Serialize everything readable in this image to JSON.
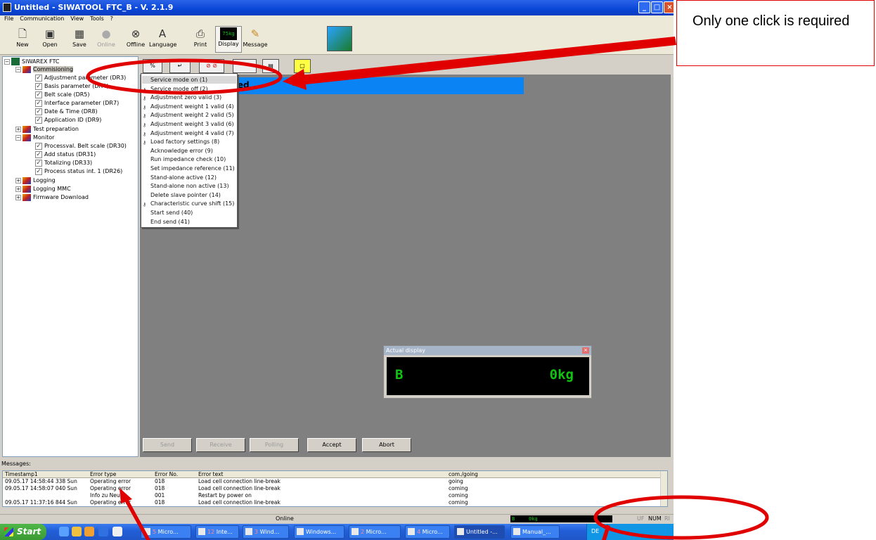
{
  "window": {
    "title": "Untitled - SIWATOOL FTC_B - V. 2.1.9",
    "menu": [
      "File",
      "Communication",
      "View",
      "Tools",
      "?"
    ]
  },
  "toolbar": {
    "new": "New",
    "open": "Open",
    "save": "Save",
    "online": "Online",
    "offline": "Offline",
    "language": "Language",
    "print": "Print",
    "display": "Display",
    "message": "Message",
    "display_icon_text": "75kg"
  },
  "tree": {
    "root": "SIWAREX FTC",
    "commissioning": "Commisioning",
    "commissioning_items": [
      "Adjustment parameter (DR3)",
      "Basis parameter (DR4)",
      "Belt scale (DR5)",
      "Interface parameter (DR7)",
      "Date & Time (DR8)",
      "Application ID (DR9)"
    ],
    "test_preparation": "Test preparation",
    "monitor": "Monitor",
    "monitor_items": [
      "Processval. Belt scale (DR30)",
      "Add status (DR31)",
      "Totalizing (DR33)",
      "Process status int. 1 (DR26)"
    ],
    "logging": "Logging",
    "logging_mmc": "Logging MMC",
    "firmware": "Firmware Download"
  },
  "main": {
    "banner_text": "cted",
    "subtool_icon_1": "%",
    "subtool_icon_2": "↵"
  },
  "dropdown": {
    "items": [
      {
        "label": "Service mode on (1)",
        "key": false,
        "highlight": true
      },
      {
        "label": "Service mode off (2)",
        "key": true,
        "highlight": false
      },
      {
        "label": "Adjustment zero valid (3)",
        "key": true,
        "highlight": false
      },
      {
        "label": "Adjustment weight 1 valid (4)",
        "key": true,
        "highlight": false
      },
      {
        "label": "Adjustment weight 2 valid (5)",
        "key": true,
        "highlight": false
      },
      {
        "label": "Adjustment weight 3 valid (6)",
        "key": true,
        "highlight": false
      },
      {
        "label": "Adjustment weight 4 valid (7)",
        "key": true,
        "highlight": false
      },
      {
        "label": "Load factory settings (8)",
        "key": true,
        "highlight": false
      },
      {
        "label": "Acknowledge error (9)",
        "key": false,
        "highlight": false
      },
      {
        "label": "Run impedance check (10)",
        "key": false,
        "highlight": false
      },
      {
        "label": "Set impedance reference (11)",
        "key": false,
        "highlight": false
      },
      {
        "label": "Stand-alone active (12)",
        "key": false,
        "highlight": false
      },
      {
        "label": "Stand-alone non active (13)",
        "key": false,
        "highlight": false
      },
      {
        "label": "Delete slave pointer (14)",
        "key": false,
        "highlight": false
      },
      {
        "label": "Characteristic curve shift (15)",
        "key": true,
        "highlight": false
      },
      {
        "label": "Start send (40)",
        "key": false,
        "highlight": false
      },
      {
        "label": "End send (41)",
        "key": false,
        "highlight": false
      }
    ]
  },
  "buttons": {
    "send": "Send",
    "receive": "Receive",
    "polling": "Polling",
    "accept": "Accept",
    "abort": "Abort"
  },
  "actual_display": {
    "title": "Actual display",
    "left": "B",
    "right": "0kg",
    "close": "×"
  },
  "messages": {
    "label": "Messages:",
    "columns": [
      "Timestamp1",
      "Error type",
      "Error No.",
      "Error text",
      "com./going"
    ],
    "rows": [
      [
        "09.05.17 14:58:44 338 Sun",
        "Operating error",
        "018",
        "Load cell connection line-break",
        "going"
      ],
      [
        "09.05.17 14:58:07 040 Sun",
        "Operating error",
        "018",
        "Load cell connection line-break",
        "coming"
      ],
      [
        "",
        "Info zu Neuan",
        "001",
        "Restart by power on",
        "coming"
      ],
      [
        "09.05.17 11:37:16 844 Sun",
        "Operating error",
        "018",
        "Load cell connection line-break",
        "coming"
      ]
    ]
  },
  "status": {
    "online": "Online",
    "disp_left": "B",
    "disp_right": "0kg",
    "uf": "UF",
    "num": "NUM",
    "ri": "RI"
  },
  "taskbar": {
    "start": "Start",
    "tasks": [
      {
        "count": "5",
        "label": "Micro..."
      },
      {
        "count": "12",
        "label": "Inte..."
      },
      {
        "count": "3",
        "label": "Wind..."
      },
      {
        "count": "",
        "label": "Windows..."
      },
      {
        "count": "2",
        "label": "Micro..."
      },
      {
        "count": "4",
        "label": "Micro..."
      },
      {
        "count": "",
        "label": "Untitled -..."
      },
      {
        "count": "",
        "label": "Manual_..."
      }
    ],
    "lang": "DE"
  },
  "annotation": {
    "callout_text": "Only one click is required",
    "accent_color": "#e00000"
  }
}
